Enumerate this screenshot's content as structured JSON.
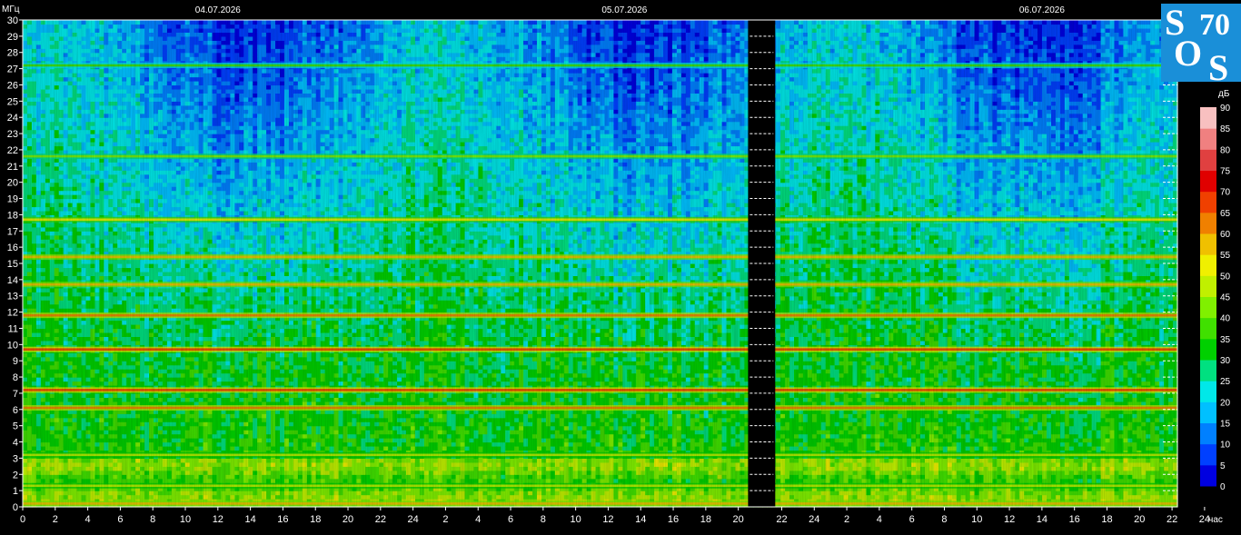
{
  "chart_data": {
    "type": "heatmap",
    "title": "",
    "ylabel": "МГц",
    "xlabel": "час",
    "colorbar_label": "дБ",
    "ylim": [
      0,
      30
    ],
    "yticks": [
      0,
      1,
      2,
      3,
      4,
      5,
      6,
      7,
      8,
      9,
      10,
      11,
      12,
      13,
      14,
      15,
      16,
      17,
      18,
      19,
      20,
      21,
      22,
      23,
      24,
      25,
      26,
      27,
      28,
      29,
      30
    ],
    "x_tick_labels": [
      "0",
      "2",
      "4",
      "6",
      "8",
      "10",
      "12",
      "14",
      "16",
      "18",
      "20",
      "22",
      "24",
      "2",
      "4",
      "6",
      "8",
      "10",
      "12",
      "14",
      "16",
      "18",
      "20",
      "22",
      "24",
      "2",
      "4",
      "6",
      "8",
      "10",
      "12",
      "14",
      "16",
      "18",
      "20",
      "22",
      "24"
    ],
    "date_labels": [
      "04.07.2026",
      "05.07.2026",
      "06.07.2026"
    ],
    "time_span_hours": [
      0,
      71
    ],
    "gap_hours": [
      44.6,
      45.6
    ],
    "colorbar": {
      "ticks": [
        0,
        5,
        10,
        15,
        20,
        25,
        30,
        35,
        40,
        45,
        50,
        55,
        60,
        65,
        70,
        75,
        80,
        85,
        90
      ],
      "colors": [
        "#0000e0",
        "#0040ff",
        "#0080ff",
        "#00c0ff",
        "#00e8e8",
        "#00e080",
        "#00d000",
        "#40e000",
        "#80f000",
        "#c0f000",
        "#f0f000",
        "#f0c000",
        "#f08000",
        "#f04000",
        "#e00000",
        "#e04040",
        "#f08080",
        "#f8c0c0",
        "#ffffff"
      ]
    },
    "emission_bands_mhz": [
      {
        "freq": 0.2,
        "level": 55
      },
      {
        "freq": 1.3,
        "level": 45
      },
      {
        "freq": 3.2,
        "level": 45
      },
      {
        "freq": 6.1,
        "level": 60
      },
      {
        "freq": 7.2,
        "level": 65
      },
      {
        "freq": 9.7,
        "level": 65
      },
      {
        "freq": 11.8,
        "level": 60
      },
      {
        "freq": 13.7,
        "level": 55
      },
      {
        "freq": 15.4,
        "level": 55
      },
      {
        "freq": 17.7,
        "level": 50
      },
      {
        "freq": 21.6,
        "level": 40
      },
      {
        "freq": 27.2,
        "level": 35
      }
    ]
  },
  "logo": {
    "text_s1": "S",
    "text_o": "O",
    "text_s2": "S",
    "text_num": "70",
    "bg_color": "#1a8fd8"
  }
}
